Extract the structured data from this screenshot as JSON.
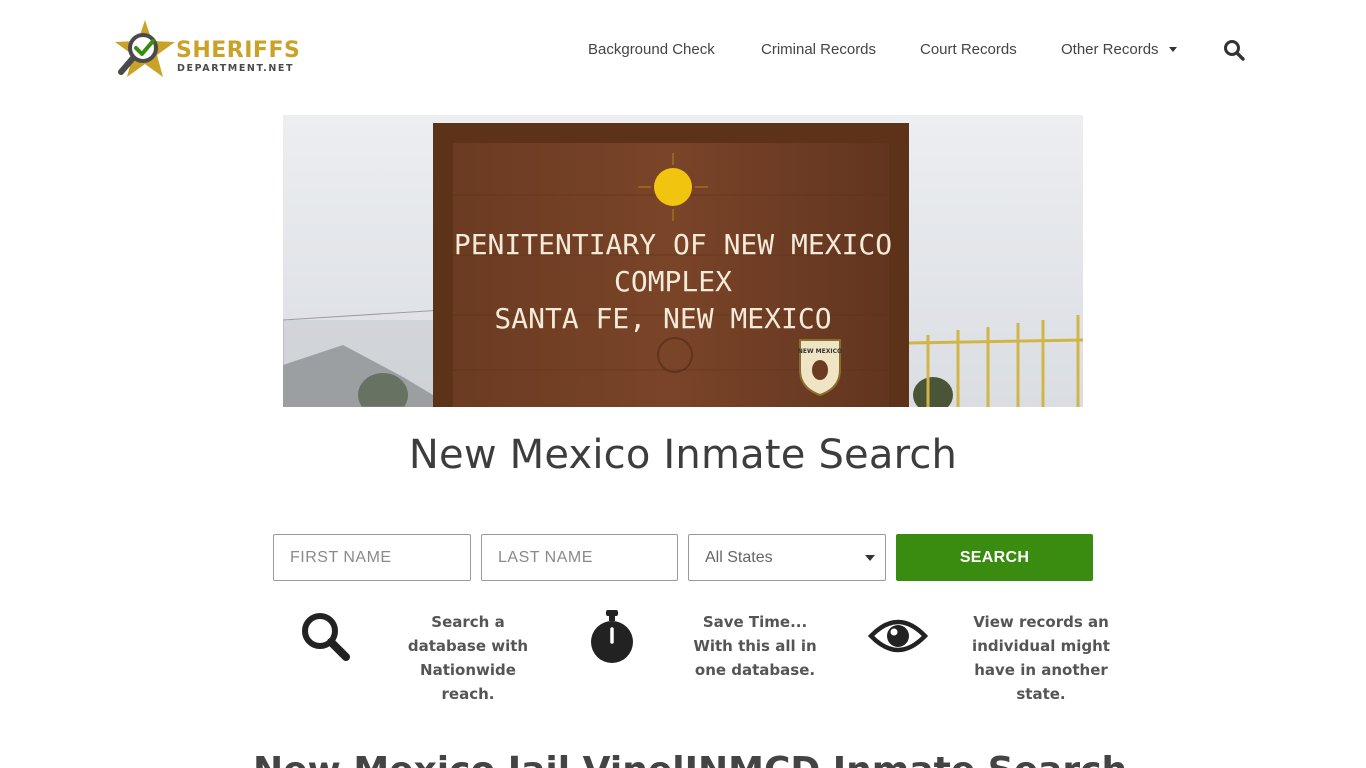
{
  "logo": {
    "name": "SHERIFFS",
    "domain": "DEPARTMENT.NET",
    "icon": "star-magnifier-check-icon",
    "colors": {
      "gold": "#c9a227",
      "green": "#3a8c10",
      "dark": "#4a4a4a"
    }
  },
  "nav": {
    "items": [
      {
        "label": "Background Check"
      },
      {
        "label": "Criminal Records"
      },
      {
        "label": "Court Records"
      },
      {
        "label": "Other Records",
        "has_dropdown": true
      }
    ],
    "search_icon": "search-icon"
  },
  "hero": {
    "sign_lines": [
      "PENITENTIARY OF  NEW  MEXICO",
      "COMPLEX",
      "SANTA  FE,     NEW  MEXICO"
    ],
    "badge_text": "NEW MEXICO"
  },
  "page": {
    "title": "New Mexico Inmate Search",
    "section_heading": "New Mexico Jail VinelINMCD Inmate Search"
  },
  "search_form": {
    "first_name_placeholder": "FIRST NAME",
    "last_name_placeholder": "LAST NAME",
    "state_selected": "All States",
    "submit_label": "SEARCH",
    "button_color": "#3a8c10"
  },
  "features": [
    {
      "icon": "magnifier-icon",
      "text": "Search a database with Nationwide reach."
    },
    {
      "icon": "stopwatch-icon",
      "text": "Save Time... With this all in one database."
    },
    {
      "icon": "eye-icon",
      "text": "View records an individual might have in another state."
    }
  ]
}
